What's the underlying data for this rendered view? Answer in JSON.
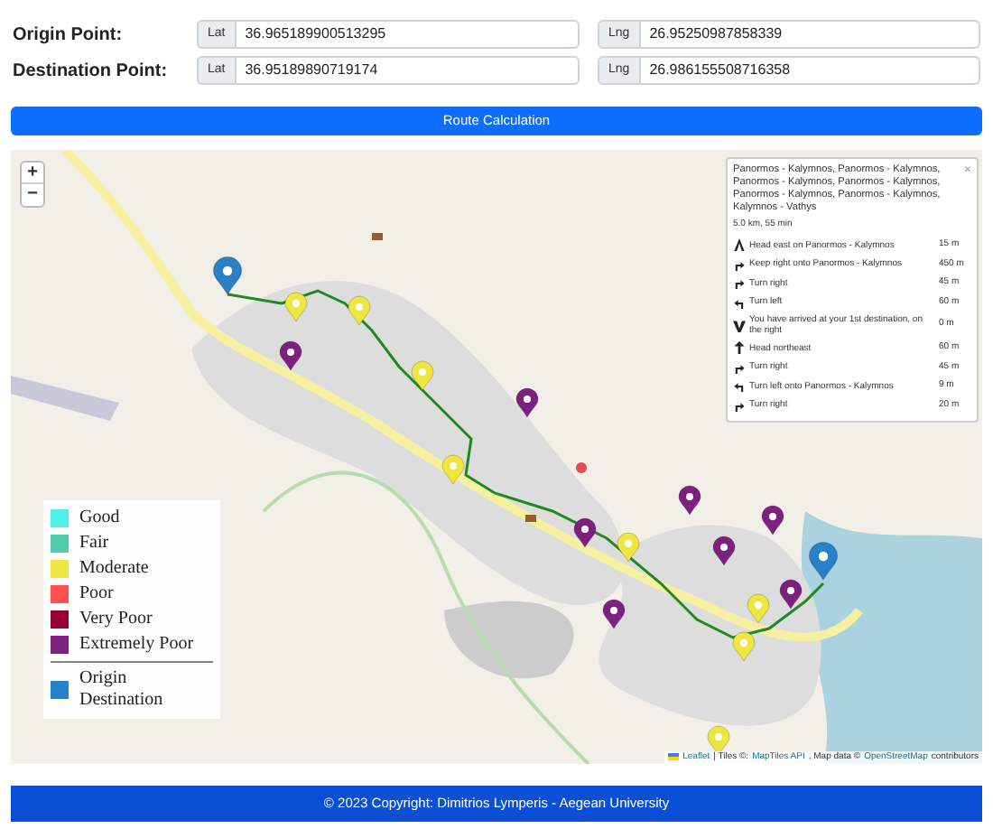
{
  "points": [
    {
      "label": "Origin Point:",
      "lat_prefix": "Lat",
      "lat": "36.965189900513295",
      "lng_prefix": "Lng",
      "lng": "26.95250987858339"
    },
    {
      "label": "Destination Point:",
      "lat_prefix": "Lat",
      "lat": "36.95189890719174",
      "lng_prefix": "Lng",
      "lng": "26.986155508716358"
    }
  ],
  "route_button": "Route Calculation",
  "map": {
    "zoom_in": "+",
    "zoom_out": "−",
    "directions": {
      "title": "Panormos - Kalymnos, Panormos - Kalymnos, Panormos - Kalymnos, Panormos - Kalymnos, Panormos - Kalymnos, Panormos - Kalymnos, Kalymnos - Vathys",
      "close": "×",
      "summary": "5.0 km, 55 min",
      "steps": [
        {
          "kind": "depart",
          "text": "Head east on Panormos - Kalymnos",
          "distance": "15 m"
        },
        {
          "kind": "right",
          "text": "Keep right onto Panormos - Kalymnos",
          "distance": "450 m"
        },
        {
          "kind": "right",
          "text": "Turn right",
          "distance": "45 m"
        },
        {
          "kind": "left",
          "text": "Turn left",
          "distance": "60 m"
        },
        {
          "kind": "arrive",
          "text": "You have arrived at your 1st destination, on the right",
          "distance": "0 m"
        },
        {
          "kind": "straight",
          "text": "Head northeast",
          "distance": "60 m"
        },
        {
          "kind": "right",
          "text": "Turn right",
          "distance": "45 m"
        },
        {
          "kind": "left",
          "text": "Turn left onto Panormos - Kalymnos",
          "distance": "9 m"
        },
        {
          "kind": "right",
          "text": "Turn right",
          "distance": "20 m"
        }
      ]
    },
    "legend": [
      {
        "kind": "level",
        "labels": [
          "Good"
        ],
        "color": "#50f0e6"
      },
      {
        "kind": "level",
        "labels": [
          "Fair"
        ],
        "color": "#50ccaa"
      },
      {
        "kind": "level",
        "labels": [
          "Moderate"
        ],
        "color": "#f0e641"
      },
      {
        "kind": "level",
        "labels": [
          "Poor"
        ],
        "color": "#ff5050"
      },
      {
        "kind": "level",
        "labels": [
          "Very Poor"
        ],
        "color": "#960032"
      },
      {
        "kind": "level",
        "labels": [
          "Extremely Poor"
        ],
        "color": "#7d2181"
      },
      {
        "kind": "marker",
        "labels": [
          "Origin",
          "Destination"
        ],
        "color": "#2a81cb"
      }
    ],
    "attribution": [
      {
        "kind": "link",
        "text": "Leaflet"
      },
      {
        "kind": "text",
        "text": "| Tiles ©:"
      },
      {
        "kind": "link",
        "text": "MapTiles API"
      },
      {
        "kind": "text",
        "text": ", Map data ©"
      },
      {
        "kind": "link",
        "text": "OpenStreetMap"
      },
      {
        "kind": "text",
        "text": "contributors"
      }
    ]
  },
  "footer": "© 2023 Copyright: Dimitrios Lymperis - Aegean University"
}
